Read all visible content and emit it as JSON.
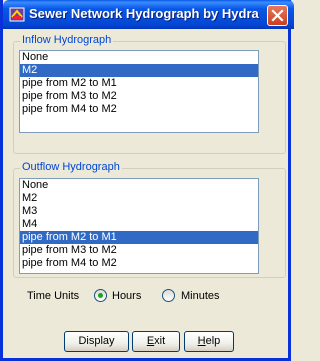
{
  "window": {
    "title": "Sewer Network Hydrograph by Hydra",
    "title_color": "#ffffff",
    "titlebar_color": "#0858e6"
  },
  "inflow": {
    "label": "Inflow Hydrograph",
    "items": [
      "None",
      "M2",
      "pipe from M2 to M1",
      "pipe from M3 to M2",
      "pipe from M4 to M2"
    ],
    "selected": "M2"
  },
  "outflow": {
    "label": "Outflow Hydrograph",
    "items": [
      "None",
      "M2",
      "M3",
      "M4",
      "pipe from M2 to M1",
      "pipe from M3 to M2",
      "pipe from M4 to M2"
    ],
    "selected": "pipe from M2 to M1"
  },
  "time_units": {
    "label": "Time Units",
    "options": [
      "Hours",
      "Minutes"
    ],
    "selected": "Hours"
  },
  "buttons": {
    "display": "Display",
    "exit": "Exit",
    "help": "Help"
  },
  "colors": {
    "selection": "#316ac5",
    "group_title": "#0046d5",
    "radio_dot": "#21a121"
  },
  "icons": {
    "app": "hydra-app-icon",
    "close": "close-icon"
  }
}
